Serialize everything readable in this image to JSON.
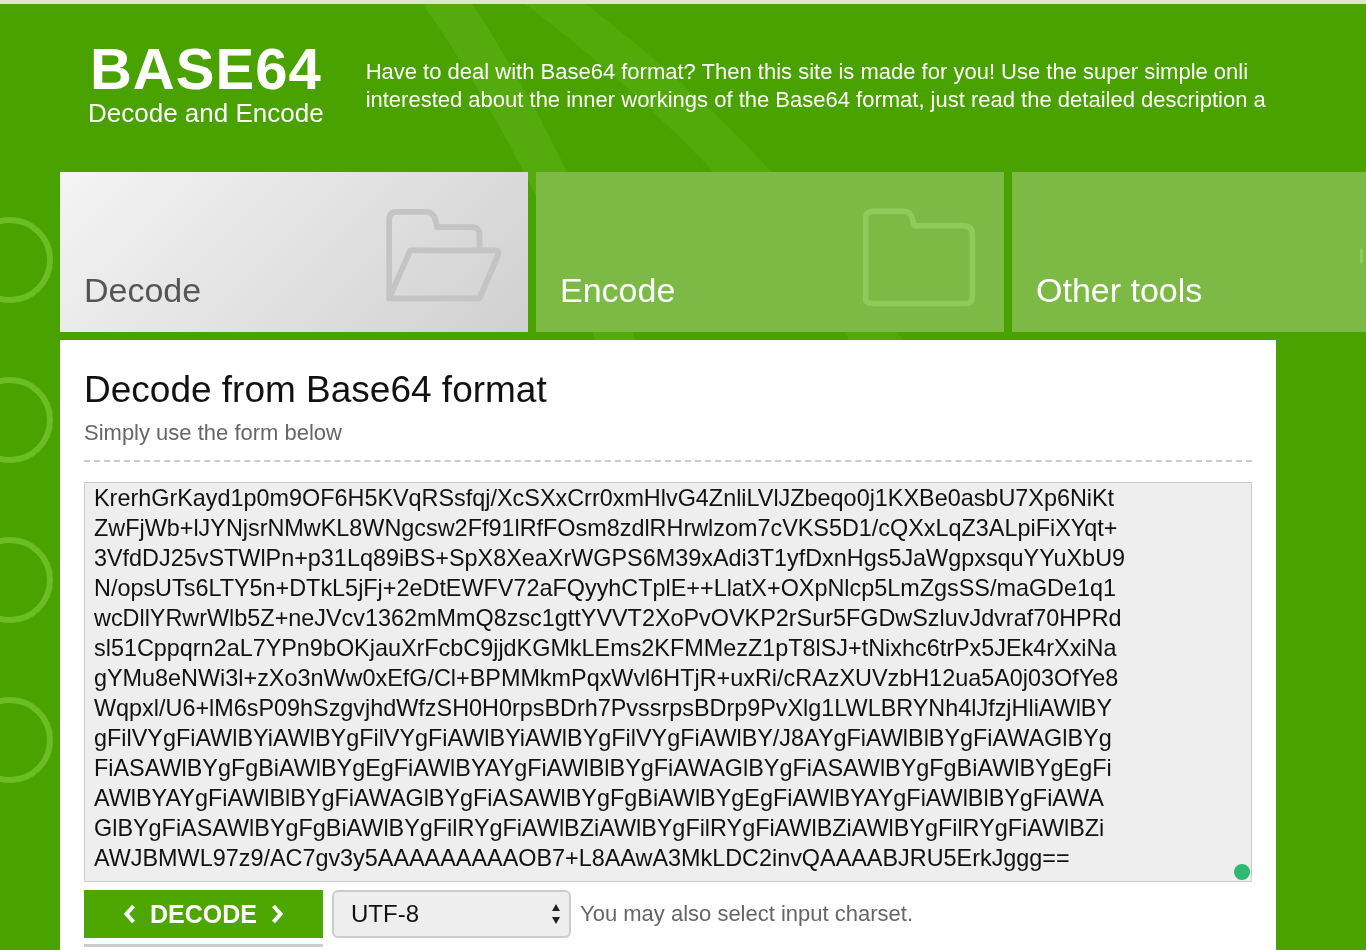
{
  "logo": {
    "title": "BASE64",
    "subtitle": "Decode and Encode"
  },
  "intro": [
    "Have to deal with Base64 format? Then this site is made for you! Use the super simple onli",
    "interested about the inner workings of the Base64 format, just read the detailed description a"
  ],
  "tabs": [
    {
      "label": "Decode",
      "selected": true,
      "kind": "open"
    },
    {
      "label": "Encode",
      "selected": false,
      "kind": "closed"
    },
    {
      "label": "Other tools",
      "selected": false,
      "kind": "cut"
    }
  ],
  "panel": {
    "title": "Decode from Base64 format",
    "subtitle": "Simply use the form below",
    "input_lines": [
      "KrerhGrKayd1p0m9OF6H5KVqRSsfqj/XcSXxCrr0xmHlvG4ZnliLVlJZbeqo0j1KXBe0asbU7Xp6NiKt",
      "ZwFjWb+lJYNjsrNMwKL8WNgcsw2Ff91lRfFOsm8zdlRHrwlzom7cVKS5D1/cQXxLqZ3ALpiFiXYqt+",
      "3VfdDJ25vSTWlPn+p31Lq89iBS+SpX8XeaXrWGPS6M39xAdi3T1yfDxnHgs5JaWgpxsquYYuXbU9",
      "N/opsUTs6LTY5n+DTkL5jFj+2eDtEWFV72aFQyyhCTplE++LlatX+OXpNlcp5LmZgsSS/maGDe1q1",
      "wcDllYRwrWlb5Z+neJVcv1362mMmQ8zsc1gttYVVT2XoPvOVKP2rSur5FGDwSzluvJdvraf70HPRd",
      "sl51Cppqrn2aL7YPn9bOKjauXrFcbC9jjdKGMkLEms2KFMMezZ1pT8lSJ+tNixhc6trPx5JEk4rXxiNa",
      "gYMu8eNWi3l+zXo3nWw0xEfG/Cl+BPMMkmPqxWvl6HTjR+uxRi/cRAzXUVzbH12ua5A0j03OfYe8",
      "Wqpxl/U6+lM6sP09hSzgvjhdWfzSH0H0rpsBDrh7PvssrpsBDrp9PvXlg1LWLBRYNh4lJfzjHliAWlBY",
      "gFilVYgFiAWlBYiAWlBYgFilVYgFiAWlBYiAWlBYgFilVYgFiAWlBY/J8AYgFiAWlBlBYgFiAWAGlBYg",
      "FiASAWlBYgFgBiAWlBYgEgFiAWlBYAYgFiAWlBlBYgFiAWAGlBYgFiASAWlBYgFgBiAWlBYgEgFi",
      "AWlBYAYgFiAWlBlBYgFiAWAGlBYgFiASAWlBYgFgBiAWlBYgEgFiAWlBYAYgFiAWlBlBYgFiAWA",
      "GlBYgFiASAWlBYgFgBiAWlBYgFilRYgFiAWlBZiAWlBYgFilRYgFiAWlBZiAWlBYgFilRYgFiAWlBZi",
      "AWJBMWL97z9/AC7gv3y5AAAAAAAAAOB7+L8AAwA3MkLDC2invQAAAABJRU5ErkJggg=="
    ],
    "button": "DECODE",
    "charset": "UTF-8",
    "charset_hint": "You may also select input charset."
  }
}
